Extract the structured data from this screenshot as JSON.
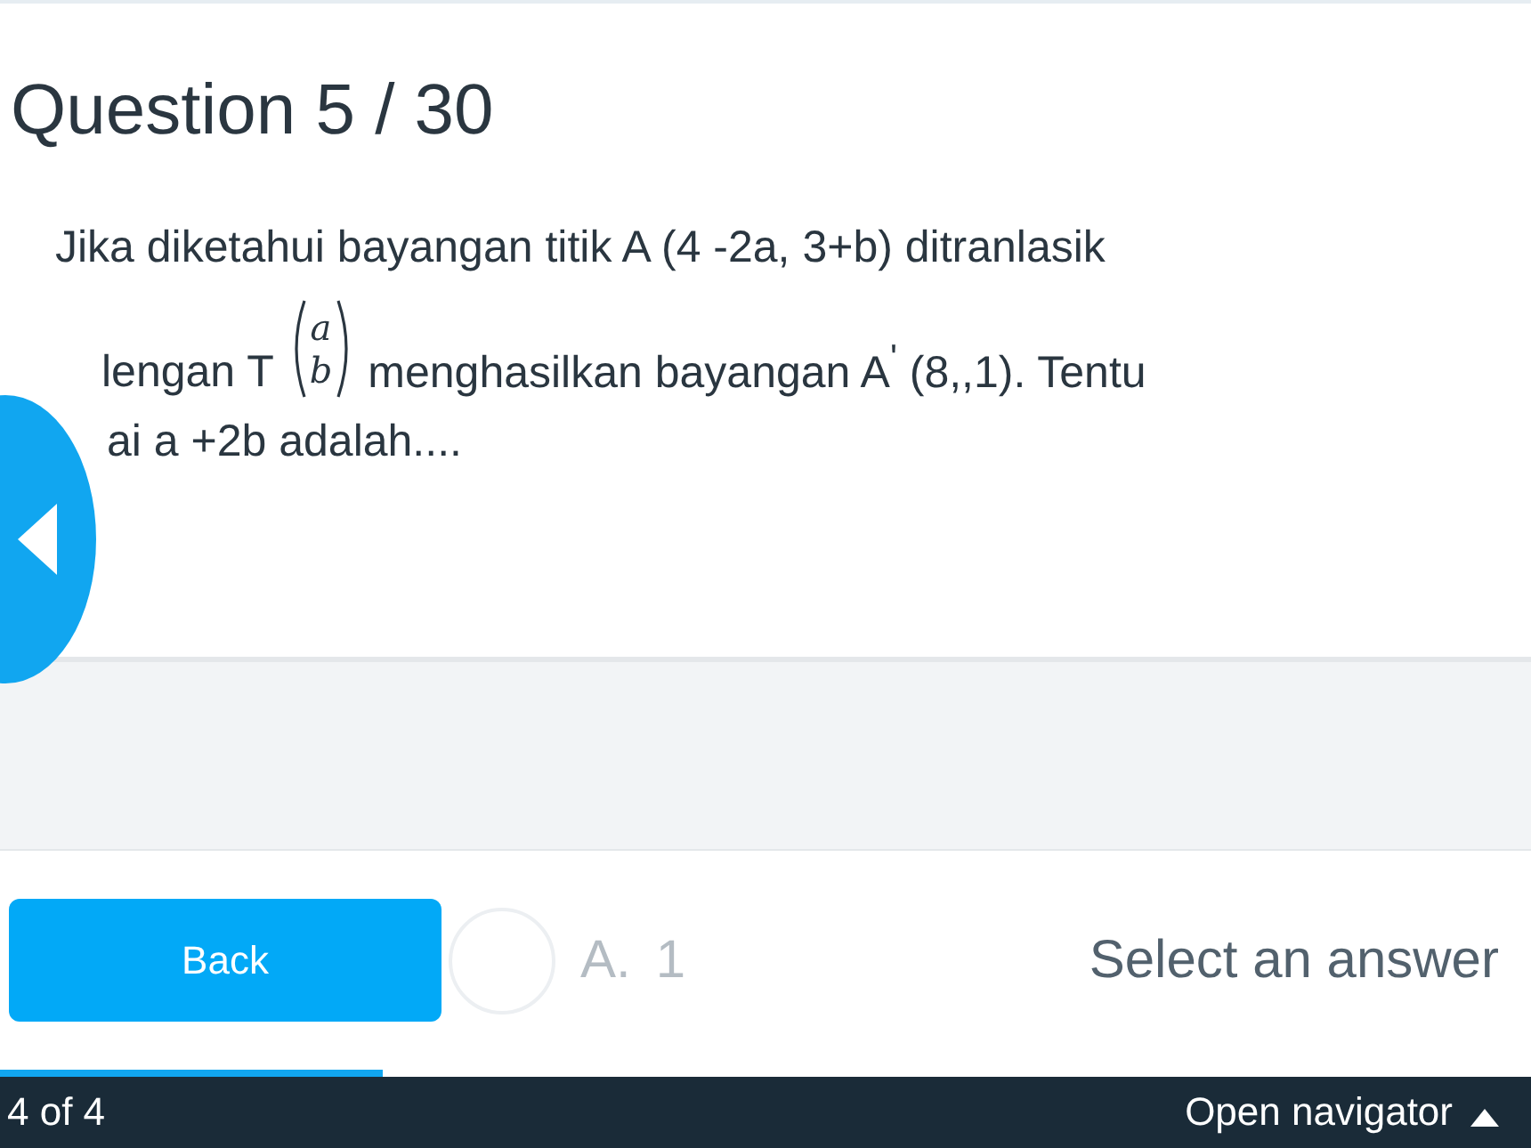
{
  "question": {
    "title": "Question 5 / 30",
    "line_1": "Jika diketahui bayangan titik A (4 -2a, 3+b) ditranlasik",
    "line_2_before": "lengan T",
    "vector": [
      "a",
      "b"
    ],
    "line_2_after": "menghasilkan bayangan A$^{'}$ (8,,1). Tentu",
    "line_3": "ai a +2b adalah...."
  },
  "answer": {
    "option_letter": "A.",
    "option_text": "1",
    "selected": false,
    "prompt": "Select an answer"
  },
  "back_button": "Back",
  "footer": {
    "level": 0.25,
    "count": "4 of 4",
    "navigator": "Open navigator"
  }
}
